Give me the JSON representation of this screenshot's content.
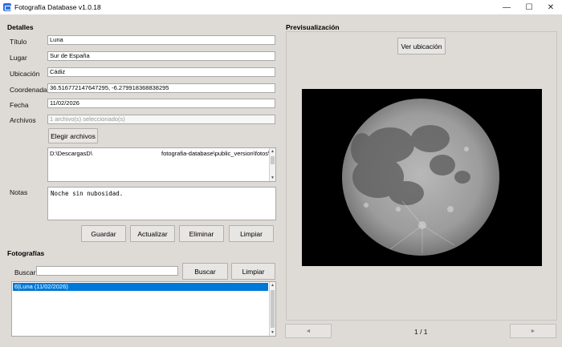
{
  "window": {
    "title": "Fotografía Database v1.0.18",
    "minimize_glyph": "—",
    "maximize_glyph": "☐",
    "close_glyph": "✕"
  },
  "details": {
    "section_title": "Detalles",
    "fields": {
      "titulo": {
        "label": "Título",
        "value": "Luna"
      },
      "lugar": {
        "label": "Lugar",
        "value": "Sur de España"
      },
      "ubicacion": {
        "label": "Ubicación",
        "value": "Cádiz"
      },
      "coordenadas": {
        "label": "Coordenadas",
        "value": "36.516772147647295, -6.279918368838295"
      },
      "fecha": {
        "label": "Fecha",
        "value": "11/02/2026"
      },
      "archivos": {
        "label": "Archivos",
        "value": "1 archivo(s) seleccionado(s)"
      }
    },
    "choose_files_label": "Elegir archivos",
    "file_path_start": "D:\\DescargasD\\",
    "file_path_end": "fotografia-database\\public_version\\fotos\\",
    "notes": {
      "label": "Notas",
      "value": "Noche sin nubosidad."
    },
    "actions": {
      "save": "Guardar",
      "update": "Actualizar",
      "delete": "Eliminar",
      "clear": "Limpiar"
    }
  },
  "photos": {
    "section_title": "Fotografías",
    "search_label": "Buscar",
    "search_value": "",
    "search_button": "Buscar",
    "clear_button": "Limpiar",
    "items": [
      {
        "label": "6|Luna (11/02/2026)",
        "selected": true
      }
    ]
  },
  "preview": {
    "section_title": "Previsualización",
    "location_button": "Ver ubicación",
    "pager": "1 / 1",
    "prev_glyph": "◄",
    "next_glyph": "►"
  },
  "colors": {
    "app_background": "#dedad5",
    "selection": "#0078d7",
    "title_icon": "#2f6fe0"
  }
}
